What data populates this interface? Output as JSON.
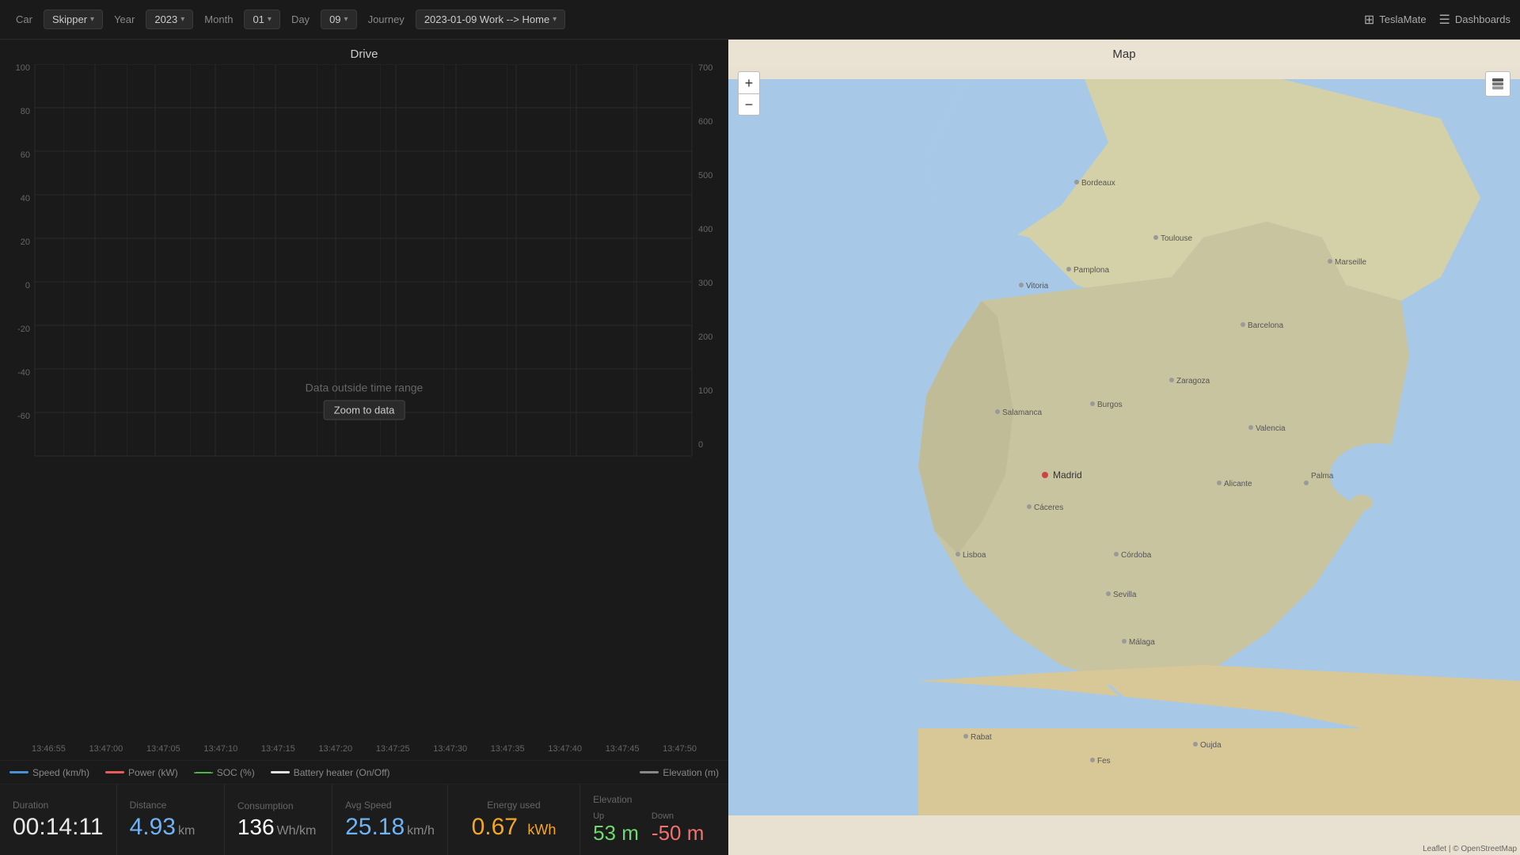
{
  "topbar": {
    "car_label": "Car",
    "car_value": "Skipper",
    "year_label": "Year",
    "year_value": "2023",
    "month_label": "Month",
    "month_value": "01",
    "day_label": "Day",
    "day_value": "09",
    "journey_label": "Journey",
    "journey_value": "2023-01-09 Work --> Home",
    "teslamate_label": "TeslaMate",
    "dashboards_label": "Dashboards"
  },
  "chart": {
    "title": "Drive",
    "message": "Data outside time range",
    "zoom_label": "Zoom to data",
    "y_left_labels": [
      "100",
      "80",
      "60",
      "40",
      "20",
      "0",
      "-20",
      "-40",
      "-60"
    ],
    "y_right_labels": [
      "700",
      "600",
      "500",
      "400",
      "300",
      "200",
      "100",
      "0"
    ],
    "x_labels": [
      "13:46:55",
      "13:47:00",
      "13:47:05",
      "13:47:10",
      "13:47:15",
      "13:47:20",
      "13:47:25",
      "13:47:30",
      "13:47:35",
      "13:47:40",
      "13:47:45",
      "13:47:50"
    ]
  },
  "legend": {
    "items": [
      {
        "label": "Speed (km/h)",
        "color": "#4a90d9"
      },
      {
        "label": "Power (kW)",
        "color": "#e85c5c"
      },
      {
        "label": "SOC (%)",
        "color": "#49b849"
      },
      {
        "label": "Battery heater (On/Off)",
        "color": "#e0e0e0"
      }
    ],
    "right_item": {
      "label": "Elevation (m)",
      "color": "#888"
    }
  },
  "stats": {
    "duration_label": "Duration",
    "duration_value": "00:14:11",
    "distance_label": "Distance",
    "distance_value": "4.93",
    "distance_unit": "km",
    "consumption_label": "Consumption",
    "consumption_value": "136",
    "consumption_unit": "Wh/km",
    "avg_speed_label": "Avg Speed",
    "avg_speed_value": "25.18",
    "avg_speed_unit": "km/h",
    "energy_title": "Energy used",
    "energy_value": "0.67",
    "energy_unit": "kWh",
    "elevation_title": "Elevation",
    "up_label": "Up",
    "up_value": "53 m",
    "down_label": "Down",
    "down_value": "-50 m"
  },
  "map": {
    "title": "Map",
    "zoom_in": "+",
    "zoom_out": "−",
    "attribution": "Leaflet | © OpenStreetMap"
  }
}
